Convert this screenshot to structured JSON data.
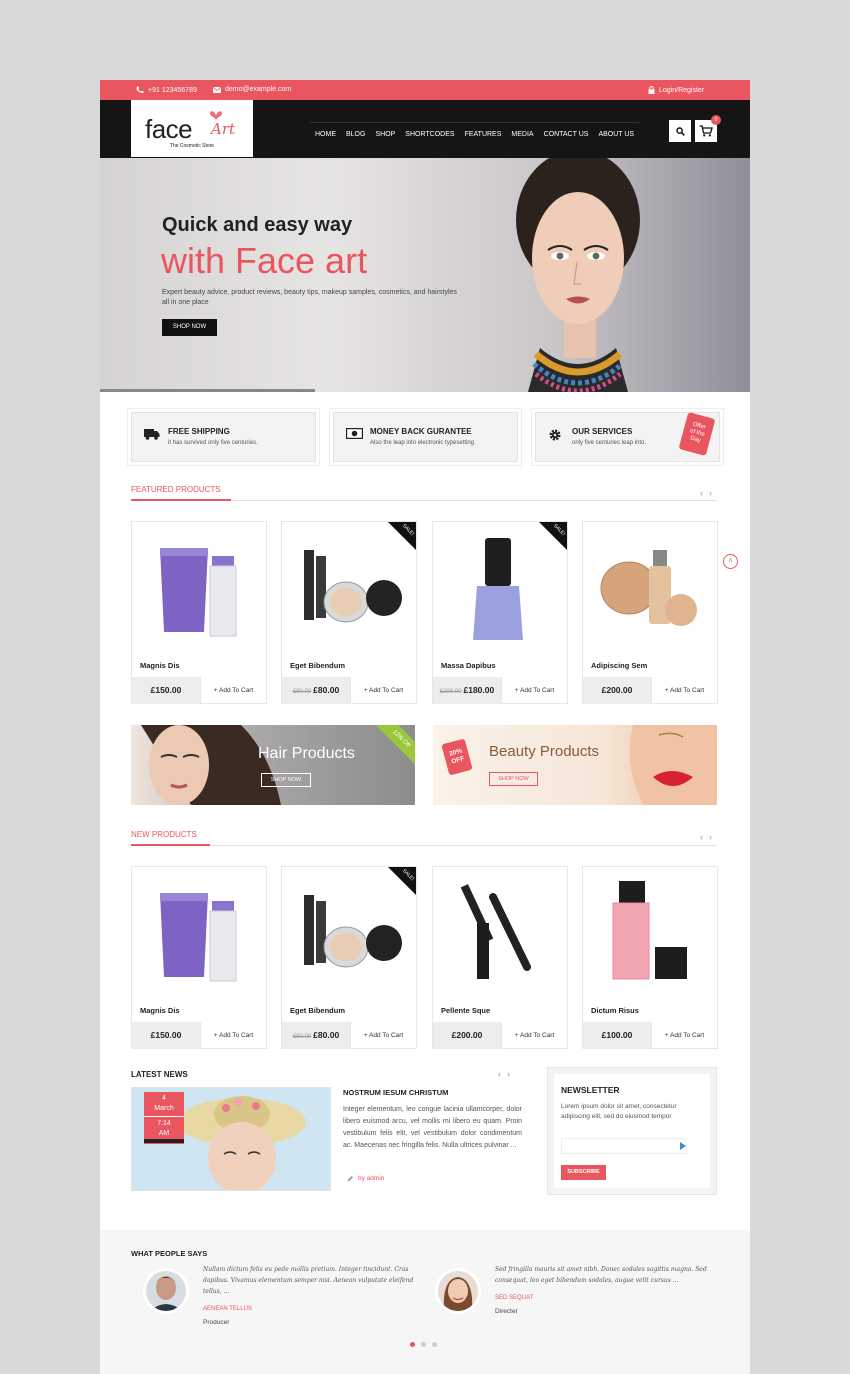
{
  "topbar": {
    "phone": "+91 123456789",
    "email": "demo@example.com",
    "login": "Login/Register"
  },
  "logo": {
    "brand_main": "face",
    "brand_accent": "Art",
    "tagline": "The Cosmetic Store"
  },
  "nav": [
    "HOME",
    "BLOG",
    "SHOP",
    "SHORTCODES",
    "FEATURES",
    "MEDIA",
    "CONTACT US",
    "ABOUT US"
  ],
  "header": {
    "cart_count": "0"
  },
  "hero": {
    "line1": "Quick and easy way",
    "line2": "with Face art",
    "text": "Expert beauty advice, product reviews, beauty tips, makeup samples, cosmetics, and hairstyles all in one place",
    "button": "SHOP NOW"
  },
  "services": [
    {
      "title": "FREE SHIPPING",
      "desc": "it has survived only five centuries.",
      "icon": "truck-icon"
    },
    {
      "title": "MONEY BACK GURANTEE",
      "desc": "Also the leap into electronic typesetting",
      "icon": "money-icon"
    },
    {
      "title": "OUR SERVICES",
      "desc": "only five centuries leap into.",
      "icon": "gear-icon"
    }
  ],
  "offer_tag": {
    "line1": "Offer",
    "line2": "of the",
    "line3": "Day"
  },
  "featured": {
    "title": "FEATURED PRODUCTS",
    "products": [
      {
        "name": "Magnis Dis",
        "price": "£150.00",
        "old_price": "",
        "sale": false,
        "cart": "Add To Cart"
      },
      {
        "name": "Eget Bibendum",
        "price": "£80.00",
        "old_price": "£90.00",
        "sale": true,
        "cart": "Add To Cart"
      },
      {
        "name": "Massa Dapibus",
        "price": "£180.00",
        "old_price": "£200.00",
        "sale": true,
        "cart": "Add To Cart"
      },
      {
        "name": "Adipiscing Sem",
        "price": "£200.00",
        "old_price": "",
        "sale": false,
        "cart": "Add To Cart"
      }
    ]
  },
  "sale_label": "SALE!",
  "banners": {
    "hair": {
      "title": "Hair Products",
      "button": "SHOP NOW",
      "ribbon": "12% Off"
    },
    "beauty": {
      "title": "Beauty Products",
      "button": "SHOP NOW",
      "tag1": "20%",
      "tag2": "OFF"
    }
  },
  "new_products": {
    "title": "NEW PRODUCTS",
    "products": [
      {
        "name": "Magnis Dis",
        "price": "£150.00",
        "old_price": "",
        "sale": false,
        "cart": "Add To Cart"
      },
      {
        "name": "Eget Bibendum",
        "price": "£80.00",
        "old_price": "£90.00",
        "sale": true,
        "cart": "Add To Cart"
      },
      {
        "name": "Pellente Sque",
        "price": "£200.00",
        "old_price": "",
        "sale": false,
        "cart": "Add To Cart"
      },
      {
        "name": "Dictum Risus",
        "price": "£100.00",
        "old_price": "",
        "sale": false,
        "cart": "Add To Cart"
      }
    ]
  },
  "news": {
    "section_title": "LATEST NEWS",
    "day": "4",
    "month": "March",
    "time1": "7:14",
    "time2": "AM",
    "title": "NOSTRUM IESUM CHRISTUM",
    "text": "Integer elementum, leo congue lacinia ullamcorper, dolor libero euismod arcu, vel mollis mi libero eu quam. Proin vestibulum felis elit, vel vestibulum dolor condimentum ac. Maecenas nec fringilla felis. Nulla ultrices pulvinar ...",
    "author": "by admin"
  },
  "newsletter": {
    "title": "NEWSLETTER",
    "text": "Lorem ipsum dolor sit amet, consectetur adipiscing elit, sed do eiusmod tempor",
    "button": "SUBSCRIBE"
  },
  "testimonials": {
    "title": "WHAT PEOPLE SAYS",
    "items": [
      {
        "quote": "Nullam dictum felis eu pede mollis pretium. Integer tincidunt. Cras dapibus. Vivamus elementum semper nisi. Aenean vulputate eleifend tellus, ...",
        "name": "AENEAN TELLUS",
        "role": "Producer"
      },
      {
        "quote": "Sed fringilla mauris sit amet nibh. Donec sodales sagittis magna. Sed consequat, leo eget bibendum sodales, augue velit cursus ...",
        "name": "SED SEQUAT",
        "role": "Directer"
      }
    ]
  },
  "colors": {
    "accent": "#e9565f",
    "dark": "#151515"
  }
}
